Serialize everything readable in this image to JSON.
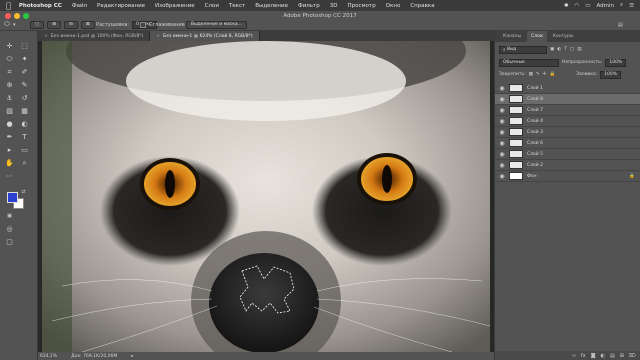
{
  "menubar": {
    "apple": "",
    "app": "Photoshop CC",
    "items": [
      "Файл",
      "Редактирование",
      "Изображение",
      "Слои",
      "Текст",
      "Выделение",
      "Фильтр",
      "3D",
      "Просмотр",
      "Окно",
      "Справка"
    ],
    "user": "Admin"
  },
  "window_title": "Adobe Photoshop CC 2017",
  "options": {
    "feather_label": "Растушевка:",
    "feather_value": "0 пикс.",
    "antialias_label": "Сглаживание",
    "select_mask_label": "Выделение и маска..."
  },
  "tabs": [
    {
      "label": "Без имени-1.psd @ 100% (Фон, RGB/8*)",
      "active": false
    },
    {
      "label": "Без имени-1 @ 624% (Слой 8, RGB/8*)",
      "active": true
    }
  ],
  "status": {
    "zoom": "624,1%",
    "doc": "Док: 769,1K/20,06M"
  },
  "panels": {
    "tabs": [
      "Каналы",
      "Слои",
      "Контуры"
    ],
    "active_tab": "Слои",
    "filter_label": "Вид",
    "blend_mode": "Обычные",
    "opacity_label": "Непрозрачность:",
    "opacity_value": "100%",
    "lock_label": "Закрепить:",
    "fill_label": "Заливка:",
    "fill_value": "100%"
  },
  "layers": [
    {
      "name": "Слой 1",
      "selected": false
    },
    {
      "name": "Слой 8",
      "selected": true
    },
    {
      "name": "Слой 7",
      "selected": false
    },
    {
      "name": "Слой 4",
      "selected": false
    },
    {
      "name": "Слой 3",
      "selected": false
    },
    {
      "name": "Слой 6",
      "selected": false
    },
    {
      "name": "Слой 5",
      "selected": false
    },
    {
      "name": "Слой 2",
      "selected": false
    },
    {
      "name": "Фон",
      "selected": false
    }
  ],
  "colors": {
    "foreground": "#2b3fd1",
    "background": "#ffffff",
    "close_dot": "#ff5f57",
    "min_dot": "#febc2e",
    "max_dot": "#28c840"
  }
}
